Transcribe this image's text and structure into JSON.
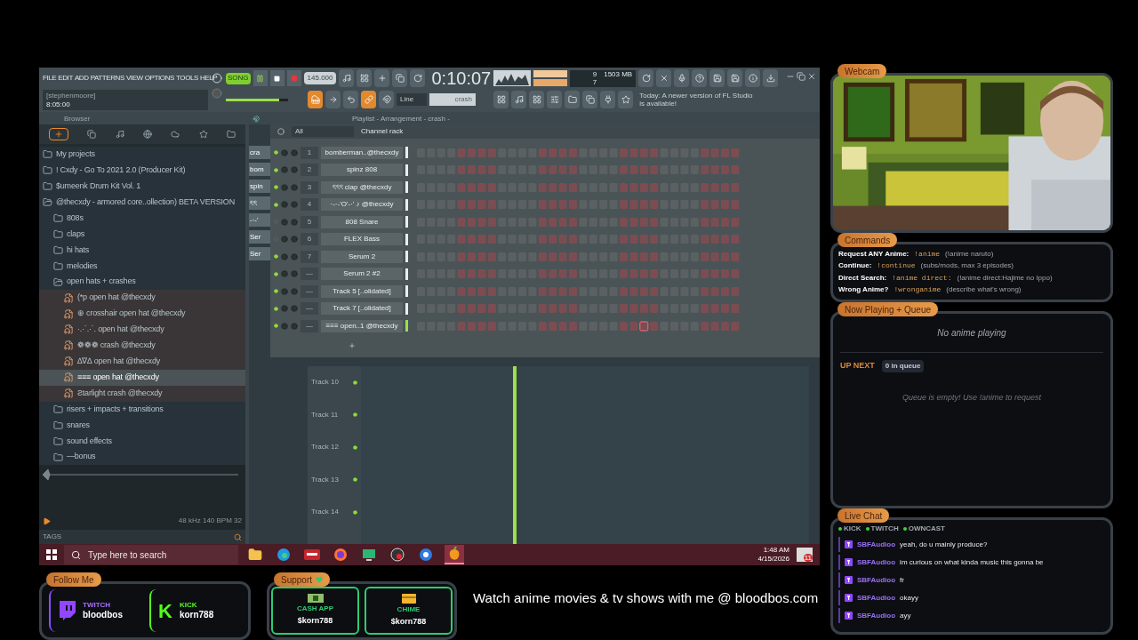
{
  "fl_studio": {
    "menu": [
      "FILE",
      "EDIT",
      "ADD",
      "PATTERNS",
      "VIEW",
      "OPTIONS",
      "TOOLS",
      "HELP"
    ],
    "transport": {
      "mode": "SONG",
      "playing": true,
      "tempo": "145.000",
      "time": "0:10:07"
    },
    "hint": {
      "title": "[stephenmoore]",
      "value": "8:05:00"
    },
    "master_volume": {
      "level": 0.86
    },
    "monitor": {
      "cpu": "9",
      "memory": "1503 MB",
      "polyphony": "7"
    },
    "snap": "Line",
    "pattern": "crash",
    "news": "Today: A newer version of FL Studio is available!",
    "browser": {
      "title": "Browser",
      "tree": [
        {
          "label": "My projects",
          "kind": "folder",
          "expanded": false,
          "selected": false
        },
        {
          "label": "! Cxdy - Go To 2021 2.0 (Producer Kit)",
          "kind": "folder",
          "expanded": false,
          "selected": false
        },
        {
          "label": "$umeenk Drum Kit Vol. 1",
          "kind": "folder",
          "expanded": false,
          "selected": false
        },
        {
          "label": "@thecxdy - armored core..ollection) BETA VERSION",
          "kind": "folder",
          "expanded": true,
          "selected": false,
          "children": [
            {
              "label": "808s",
              "kind": "folder",
              "expanded": false,
              "selected": false
            },
            {
              "label": "claps",
              "kind": "folder",
              "expanded": false,
              "selected": false
            },
            {
              "label": "hi hats",
              "kind": "folder",
              "expanded": false,
              "selected": false
            },
            {
              "label": "melodies",
              "kind": "folder",
              "expanded": false,
              "selected": false
            },
            {
              "label": "open hats + crashes",
              "kind": "folder",
              "expanded": true,
              "selected": false,
              "children": [
                {
                  "label": "(*p open hat @thecxdy",
                  "kind": "file",
                  "selected": false
                },
                {
                  "label": "⊕ crosshair open hat @thecxdy",
                  "kind": "file",
                  "selected": false
                },
                {
                  "label": "·.·˙.·˙. open hat @thecxdy",
                  "kind": "file",
                  "selected": false
                },
                {
                  "label": "❁❁❁ crash @thecxdy",
                  "kind": "file",
                  "selected": false
                },
                {
                  "label": "∆∇∆ open hat @thecxdy",
                  "kind": "file",
                  "selected": false
                },
                {
                  "label": "≡≡≡ open hat @thecxdy",
                  "kind": "file",
                  "selected": true
                },
                {
                  "label": "Ƨtarlight crash @thecxdy",
                  "kind": "file",
                  "selected": false
                }
              ]
            },
            {
              "label": "risers + impacts + transitions",
              "kind": "folder",
              "expanded": false,
              "selected": false
            },
            {
              "label": "snares",
              "kind": "folder",
              "expanded": false,
              "selected": false
            },
            {
              "label": "sound effects",
              "kind": "folder",
              "expanded": false,
              "selected": false
            },
            {
              "label": "—bonus",
              "kind": "folder",
              "expanded": false,
              "selected": false
            }
          ]
        }
      ],
      "sample_info": "48 kHz 140 BPM 32",
      "tags_label": "TAGS"
    },
    "playlist": {
      "title": "Playlist - Arrangement - crash -",
      "clips": [
        "cra",
        "bom",
        "spin",
        "ৎৎ",
        "-·-'",
        "Ser",
        "Ser"
      ],
      "tracks": [
        "Track 10",
        "Track 11",
        "Track 12",
        "Track 13",
        "Track 14"
      ]
    },
    "channel_rack": {
      "filter": "All",
      "title": "Channel rack",
      "channels": [
        {
          "number": "1",
          "name": "bomberman..@thecxdy",
          "enabled": true,
          "selected": false
        },
        {
          "number": "2",
          "name": "spinz 808",
          "enabled": true,
          "selected": false
        },
        {
          "number": "3",
          "name": "ৎৎৎ clap @thecxdy",
          "enabled": true,
          "selected": false
        },
        {
          "number": "4",
          "name": "·-·-'O'-·' ♪ @thecxdy",
          "enabled": true,
          "selected": false
        },
        {
          "number": "5",
          "name": "808 Snare",
          "enabled": false,
          "selected": false
        },
        {
          "number": "6",
          "name": "FLEX Bass",
          "enabled": false,
          "selected": false
        },
        {
          "number": "7",
          "name": "Serum 2",
          "enabled": true,
          "selected": false
        },
        {
          "number": "—",
          "name": "Serum 2 #2",
          "enabled": true,
          "selected": false
        },
        {
          "number": "—",
          "name": "Track 5 [..olidated]",
          "enabled": true,
          "selected": false
        },
        {
          "number": "—",
          "name": "Track 7 [..olidated]",
          "enabled": true,
          "selected": false
        },
        {
          "number": "—",
          "name": "≡≡≡ open..1 @thecxdy",
          "enabled": true,
          "selected": true
        }
      ]
    }
  },
  "taskbar": {
    "search_placeholder": "Type here to search",
    "apps": [
      {
        "kind": "folder",
        "active": false
      },
      {
        "kind": "edge",
        "active": false
      },
      {
        "kind": "mixer",
        "active": false
      },
      {
        "kind": "firefox",
        "active": false
      },
      {
        "kind": "monitor",
        "active": false
      },
      {
        "kind": "obs",
        "active": false
      },
      {
        "kind": "swirl",
        "active": false
      },
      {
        "kind": "fruit",
        "active": true
      }
    ],
    "time": "1:48 AM",
    "date": "4/15/2026",
    "notifications": "11"
  },
  "overlay": {
    "webcam_label": "Webcam",
    "commands": {
      "label": "Commands",
      "rows": [
        {
          "name": "Request ANY Anime:",
          "command": "!anime",
          "hint": "(!anime naruto)"
        },
        {
          "name": "Continue:",
          "command": "!continue",
          "hint": "(subs/mods, max 3 episodes)"
        },
        {
          "name": "Direct Search:",
          "command": "!anime direct:",
          "hint": "(!anime direct:Hajime no Ippo)"
        },
        {
          "name": "Wrong Anime?",
          "command": "!wronganime",
          "hint": "(describe what's wrong)"
        }
      ]
    },
    "queue": {
      "label": "Now Playing + Queue",
      "now_playing": "No anime playing",
      "up_next": "UP NEXT",
      "count": "0 in queue",
      "empty": "Queue is empty! Use !anime to request"
    },
    "chat": {
      "label": "Live Chat",
      "platforms": [
        {
          "name": "KICK",
          "color": "#3fd13f"
        },
        {
          "name": "TWITCH",
          "color": "#3fd13f"
        },
        {
          "name": "OWNCAST",
          "color": "#3fd13f"
        }
      ],
      "messages": [
        {
          "user": "SBFAudioo",
          "text": "yeah, do u mainly produce?"
        },
        {
          "user": "SBFAudioo",
          "text": "im curious on what kinda music this gonna be"
        },
        {
          "user": "SBFAudioo",
          "text": "fr"
        },
        {
          "user": "SBFAudioo",
          "text": "okayy"
        },
        {
          "user": "SBFAudioo",
          "text": "ayy"
        }
      ]
    },
    "follow": {
      "label": "Follow Me",
      "accounts": [
        {
          "kind": "twitch",
          "platform": "TWITCH",
          "handle": "bloodbos"
        },
        {
          "kind": "kick",
          "logo": "K",
          "platform": "KICK",
          "handle": "korn788"
        }
      ]
    },
    "support": {
      "label": "Support",
      "methods": [
        {
          "kind": "cash",
          "label": "CASH APP",
          "handle": "$korn788"
        },
        {
          "kind": "card",
          "label": "CHIME",
          "handle": "$korn788"
        }
      ]
    },
    "banner": "Watch anime movies & tv shows with me @ bloodbos.com"
  }
}
